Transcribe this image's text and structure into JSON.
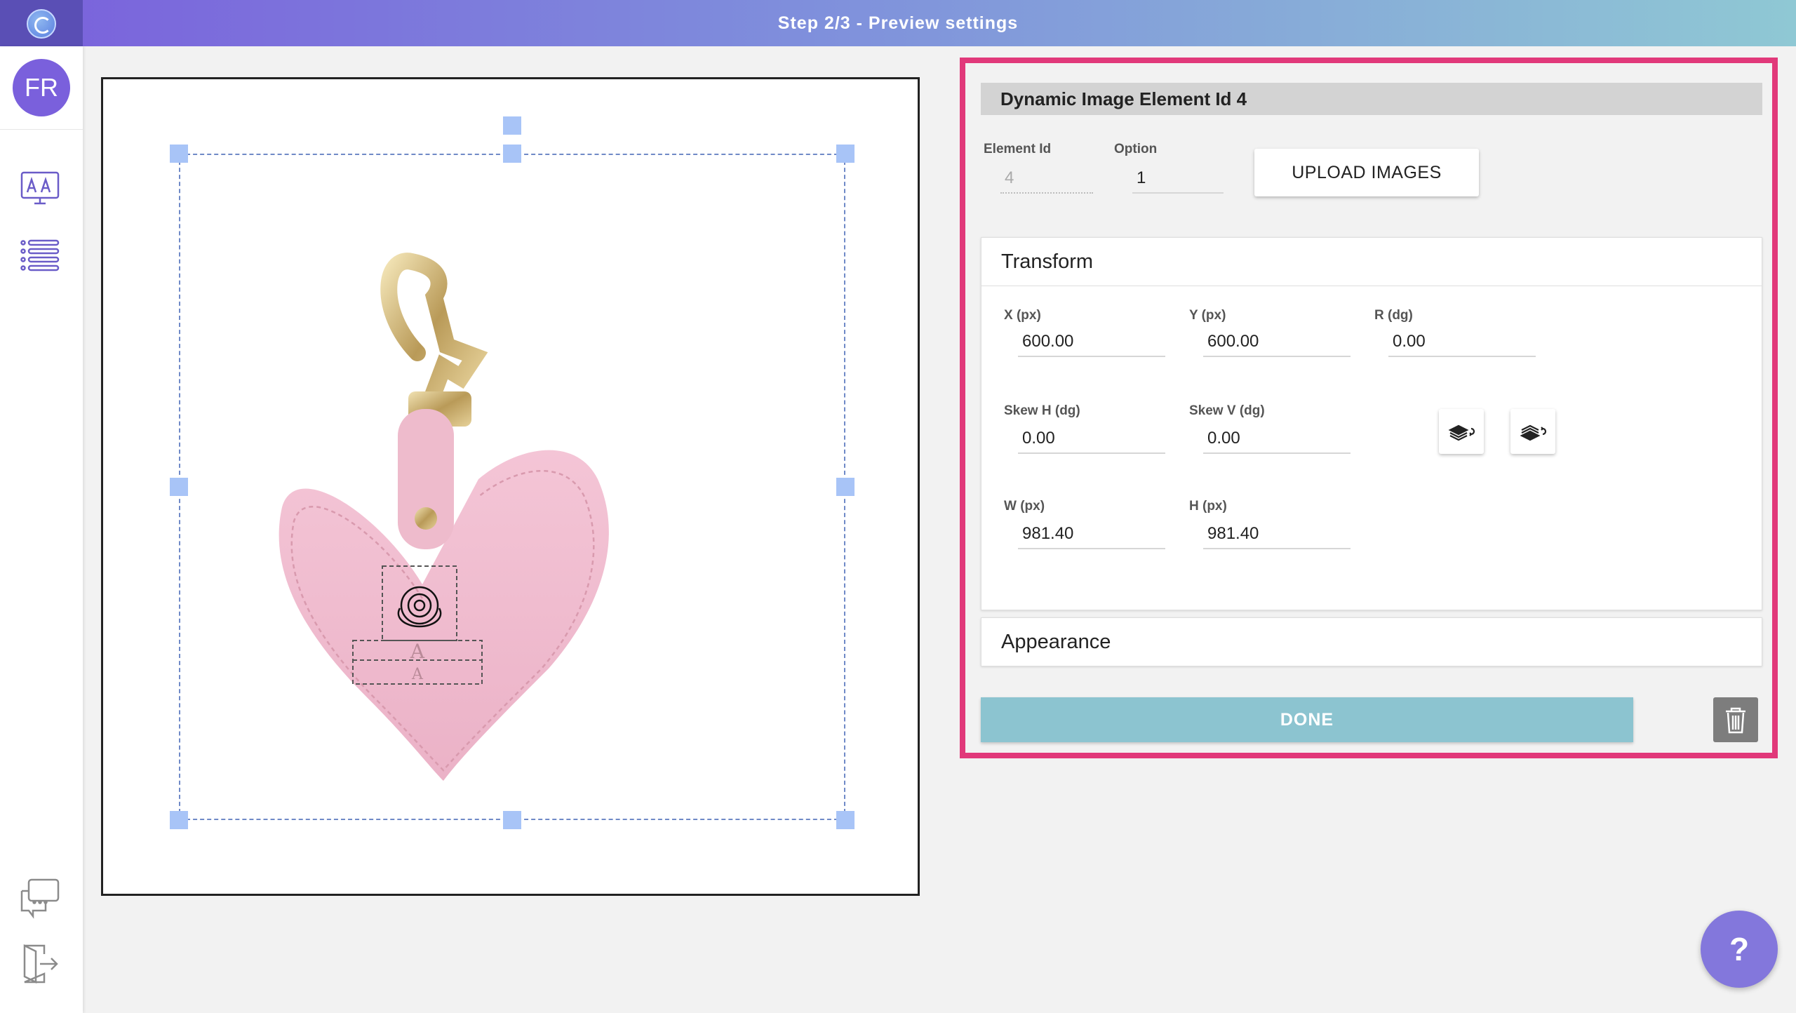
{
  "header": {
    "title": "Step 2/3 - Preview settings",
    "logo_icon": "swirl-logo-icon"
  },
  "sidebar": {
    "avatar_initials": "FR",
    "items": [
      {
        "icon": "design-monitor-icon"
      },
      {
        "icon": "list-icon"
      },
      {
        "icon": "chat-icon"
      },
      {
        "icon": "logout-door-icon"
      }
    ]
  },
  "panel": {
    "title": "Dynamic Image Element Id 4",
    "element_id": {
      "label": "Element Id",
      "value": "4"
    },
    "option": {
      "label": "Option",
      "value": "1"
    },
    "upload_label": "UPLOAD IMAGES",
    "transform": {
      "title": "Transform",
      "x": {
        "label": "X (px)",
        "value": "600.00"
      },
      "y": {
        "label": "Y (px)",
        "value": "600.00"
      },
      "r": {
        "label": "R (dg)",
        "value": "0.00"
      },
      "skew_h": {
        "label": "Skew H (dg)",
        "value": "0.00"
      },
      "skew_v": {
        "label": "Skew V (dg)",
        "value": "0.00"
      },
      "w": {
        "label": "W (px)",
        "value": "981.40"
      },
      "h": {
        "label": "H (px)",
        "value": "981.40"
      }
    },
    "appearance_title": "Appearance",
    "done_label": "DONE"
  },
  "help_label": "?",
  "colors": {
    "accent": "#7a60dc",
    "highlight_border": "#e1397a",
    "done": "#8cc4d0"
  }
}
